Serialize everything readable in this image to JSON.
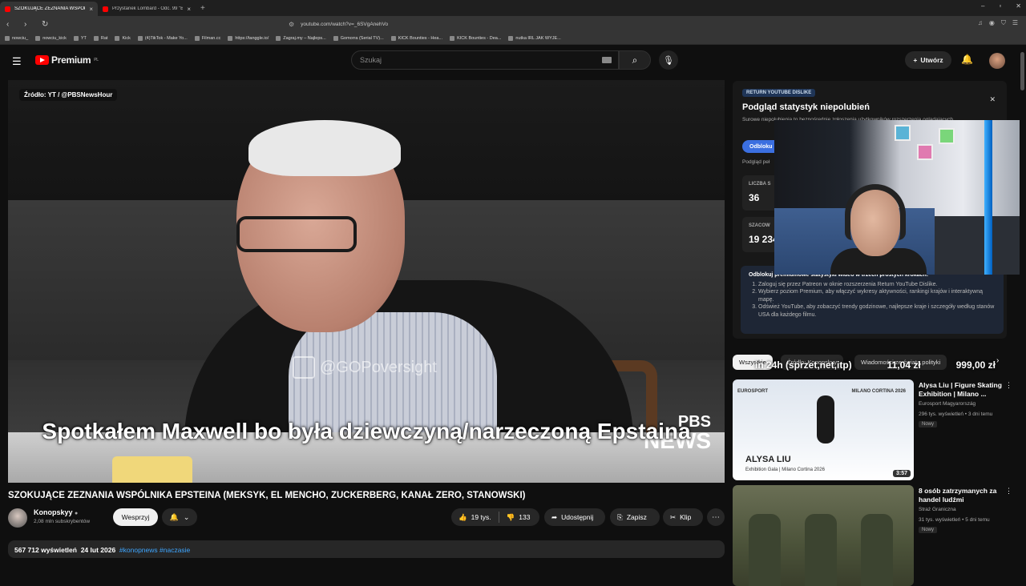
{
  "browser": {
    "tabs": [
      {
        "title": "SZOKUJĄCE ZEZNANIA WSPÓŁ",
        "active": true
      },
      {
        "title": "Przystanek Lombard - Odc. 99 \"Bez y",
        "active": false
      }
    ],
    "url": "youtube.com/watch?v=_6SVgAnehVo",
    "bookmarks": [
      "nowciu_",
      "nowciu_kick",
      "YT",
      "Rat",
      "Kick",
      "(4)TikTok - Make Yo...",
      "Filman.cc",
      "https://tanggle.io/",
      "Zagraj.my – Najleps...",
      "Gomorra (Serial TV)...",
      "KICK Bounties - Hea...",
      "KICK Bounties - Dea...",
      "nutka IRL JAK WYJE..."
    ]
  },
  "masthead": {
    "logo_text": "Premium",
    "logo_region": "PL",
    "search_placeholder": "Szukaj",
    "create_label": "Utwórz"
  },
  "player": {
    "source_badge": "Źródło: YT / @PBSNewsHour",
    "watermark": "@GOPoversight",
    "pbs_line1": "PBS",
    "pbs_line2": "NEWS",
    "subtitle": "Spotkałem Maxwell bo była dziewczyną/narzeczoną Epstaina"
  },
  "video": {
    "title": "SZOKUJĄCE ZEZNANIA WSPÓLNIKA EPSTEINA (MEKSYK, EL MENCHO, ZUCKERBERG, KANAŁ ZERO, STANOWSKI)",
    "channel": "Konopskyy",
    "subscribers": "2,08 mln subskrybentów",
    "support_label": "Wesprzyj",
    "likes": "19 tys.",
    "dislikes": "133",
    "share_label": "Udostępnij",
    "save_label": "Zapisz",
    "clip_label": "Klip",
    "views": "567 712 wyświetleń",
    "date": "24 lut 2026",
    "tags": "#konopnews #naczasie"
  },
  "ryd_panel": {
    "tag": "RETURN YOUTUBE DISLIKE",
    "heading": "Podgląd statystyk niepolubień",
    "paragraph": "Surowe niepolubienia to bezpośrednie zgłoszenia użytkowników rozszerzenia oglądających",
    "button": "Odbloku",
    "small": "Podgląd peł",
    "stat1_label": "LICZBA S",
    "stat1_value": "36",
    "stat2_label": "SZACOW",
    "stat2_value": "19 234",
    "steps_heading": "Odblokuj premiumowe statystyki wideo w trzech prostych krokach:",
    "steps": [
      "Zaloguj się przez Patreon w oknie rozszerzenia Return YouTube Dislike.",
      "Wybierz poziom Premium, aby włączyć wykresy aktywności, rankingi krajów i interaktywną mapę.",
      "Odśwież YouTube, aby zobaczyć trendy godzinowe, najlepsze kraje i szczegóły według stanów USA dla każdego filmu."
    ]
  },
  "chips": [
    "Wszystkie",
    "Źródło: Konopskyy",
    "Wiadomości ze świata polityki"
  ],
  "stream_overlay": {
    "left": "in 24h (sprzet,net,itp)",
    "mid": "11,04 zł",
    "right": "999,00 zł"
  },
  "recommendations": [
    {
      "title": "Alysa Liu | Figure Skating Exhibition | Milano ...",
      "channel": "Eurosport Magyarország",
      "meta": "296 tys. wyświetleń • 3 dni temu",
      "badge": "Nowy",
      "duration": "3:57",
      "thumb_name": "ALYSA LIU",
      "thumb_sub": "Exhibition Gala | Milano Cortina 2026",
      "thumb_logo_left": "EUROSPORT",
      "thumb_logo_right": "MILANO CORTINA 2026"
    },
    {
      "title": "8 osób zatrzymanych za handel ludźmi",
      "channel": "Straż Graniczna",
      "meta": "31 tys. wyświetleń • 5 dni temu",
      "badge": "Nowy"
    }
  ]
}
